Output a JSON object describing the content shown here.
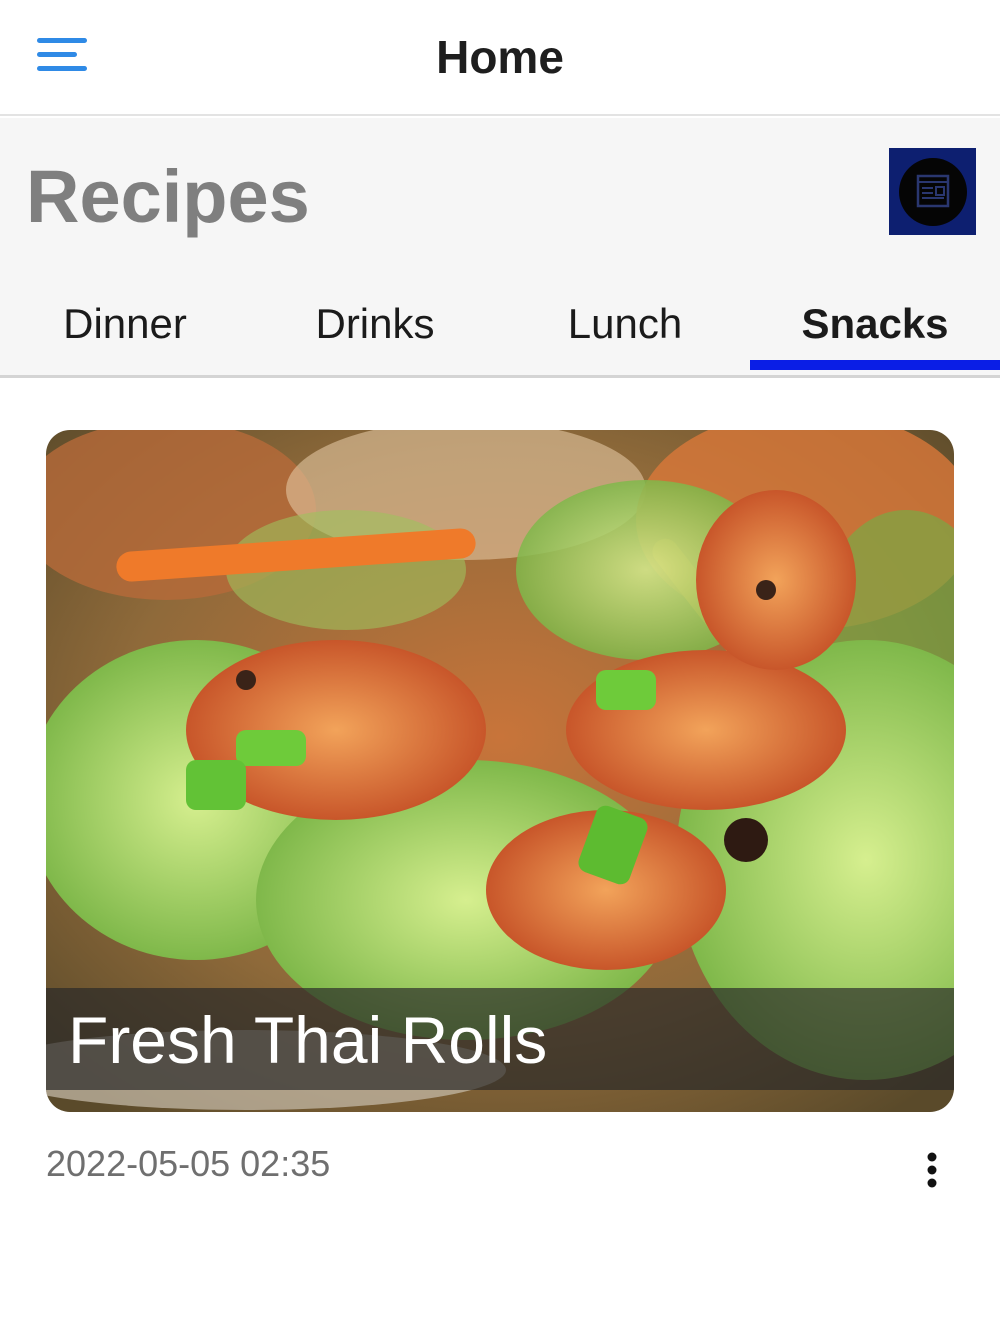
{
  "topbar": {
    "title": "Home",
    "menu_icon": "hamburger-menu-icon",
    "accent_color": "#2f8ae6"
  },
  "header": {
    "title": "Recipes",
    "feed_icon": "news-feed-icon"
  },
  "tabs": [
    {
      "label": "Dinner",
      "active": false
    },
    {
      "label": "Drinks",
      "active": false
    },
    {
      "label": "Lunch",
      "active": false
    },
    {
      "label": "Snacks",
      "active": true
    }
  ],
  "colors": {
    "tab_indicator": "#0a1ee6",
    "feed_button_bg": "#0d1f70"
  },
  "recipe": {
    "title": "Fresh Thai Rolls",
    "timestamp": "2022-05-05 02:35",
    "more_icon": "more-vertical-icon"
  }
}
